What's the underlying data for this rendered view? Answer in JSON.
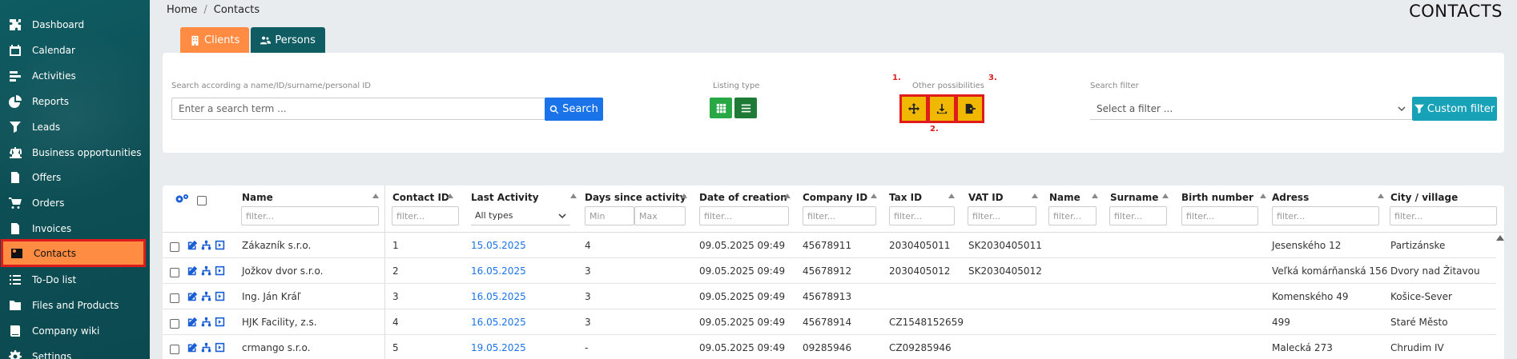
{
  "sidebar": {
    "items": [
      {
        "label": "Dashboard",
        "icon": "puzzle-icon"
      },
      {
        "label": "Calendar",
        "icon": "calendar-icon"
      },
      {
        "label": "Activities",
        "icon": "activities-icon"
      },
      {
        "label": "Reports",
        "icon": "pie-chart-icon"
      },
      {
        "label": "Leads",
        "icon": "leads-icon"
      },
      {
        "label": "Business opportunities",
        "icon": "scales-icon"
      },
      {
        "label": "Offers",
        "icon": "document-icon"
      },
      {
        "label": "Orders",
        "icon": "cart-icon"
      },
      {
        "label": "Invoices",
        "icon": "invoice-icon"
      },
      {
        "label": "Contacts",
        "icon": "contact-card-icon",
        "active": true
      },
      {
        "label": "To-Do list",
        "icon": "list-icon"
      },
      {
        "label": "Files and Products",
        "icon": "folder-icon"
      },
      {
        "label": "Company wiki",
        "icon": "book-icon"
      },
      {
        "label": "Settings",
        "icon": "gear-icon"
      }
    ]
  },
  "breadcrumb": {
    "home": "Home",
    "sep": "/",
    "current": "Contacts"
  },
  "page_title": "CONTACTS",
  "tabs": {
    "clients": "Clients",
    "persons": "Persons"
  },
  "search": {
    "label": "Search according a name/ID/surname/personal ID",
    "placeholder": "Enter a search term ...",
    "button": "Search"
  },
  "listing": {
    "label": "Listing type"
  },
  "other": {
    "label": "Other possibilities",
    "num1": "1.",
    "num2": "2.",
    "num3": "3."
  },
  "filter": {
    "label": "Search filter",
    "placeholder": "Select a filter ...",
    "custom_button": "Custom filter"
  },
  "table": {
    "headers": {
      "name": "Name",
      "contact_id": "Contact ID",
      "last_activity": "Last Activity",
      "days_since": "Days since activity",
      "date_creation": "Date of creation",
      "company_id": "Company ID",
      "tax_id": "Tax ID",
      "vat_id": "VAT ID",
      "person_name": "Name",
      "surname": "Surname",
      "birth_number": "Birth number",
      "adress": "Adress",
      "city": "City / village"
    },
    "filters": {
      "filter": "filter...",
      "all_types": "All types",
      "min": "Min",
      "max": "Max"
    },
    "rows": [
      {
        "name": "Zákazník s.r.o.",
        "contact_id": "1",
        "last_activity": "15.05.2025",
        "days": "4",
        "created": "09.05.2025 09:49",
        "company_id": "45678911",
        "tax_id": "2030405011",
        "vat_id": "SK2030405011",
        "adress": "Jesenského 12",
        "city": "Partizánske"
      },
      {
        "name": "Jožkov dvor s.r.o.",
        "contact_id": "2",
        "last_activity": "16.05.2025",
        "days": "3",
        "created": "09.05.2025 09:49",
        "company_id": "45678912",
        "tax_id": "2030405012",
        "vat_id": "SK2030405012",
        "adress": "Veľká komárňanská 156",
        "city": "Dvory nad Žitavou"
      },
      {
        "name": "Ing. Ján Kráľ",
        "contact_id": "3",
        "last_activity": "16.05.2025",
        "days": "3",
        "created": "09.05.2025 09:49",
        "company_id": "45678913",
        "tax_id": "",
        "vat_id": "",
        "adress": "Komenského 49",
        "city": "Košice-Sever"
      },
      {
        "name": "HJK Facility, z.s.",
        "contact_id": "4",
        "last_activity": "16.05.2025",
        "days": "3",
        "created": "09.05.2025 09:49",
        "company_id": "45678914",
        "tax_id": "CZ1548152659",
        "vat_id": "",
        "adress": "499",
        "city": "Staré Město"
      },
      {
        "name": "crmango s.r.o.",
        "contact_id": "5",
        "last_activity": "19.05.2025",
        "days": "-",
        "created": "09.05.2025 09:49",
        "company_id": "09285946",
        "tax_id": "CZ09285946",
        "vat_id": "",
        "adress": "Malecká 273",
        "city": "Chrudim IV"
      }
    ]
  },
  "colors": {
    "accent": "#ff8c42",
    "sidebar": "#0f5c63",
    "primary": "#1a73e8",
    "highlight": "#e01b1b"
  }
}
